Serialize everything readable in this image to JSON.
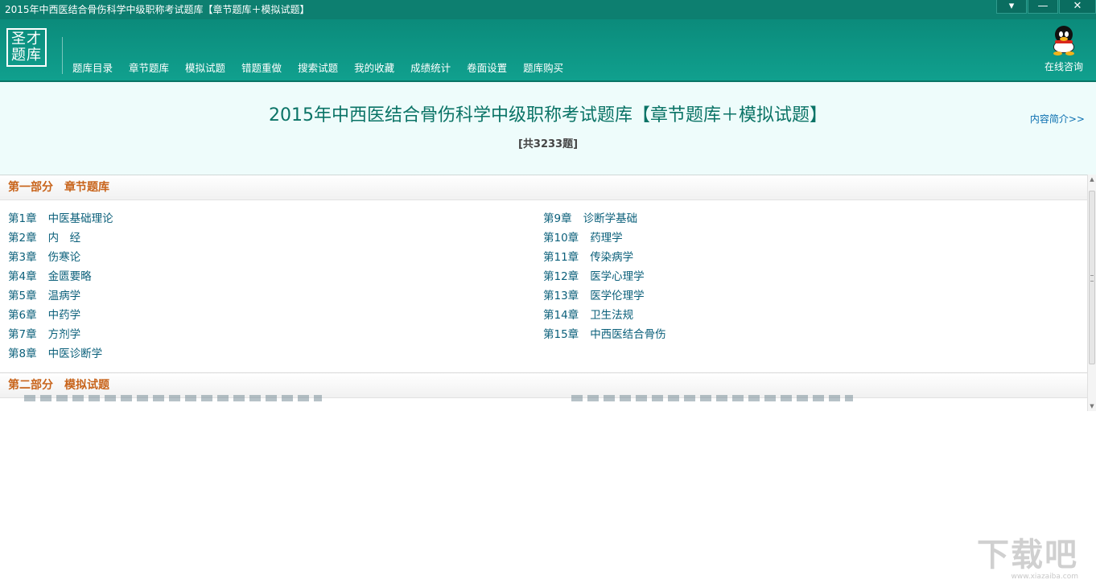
{
  "window": {
    "title": "2015年中西医结合骨伤科学中级职称考试题库【章节题库＋模拟试题】",
    "controls": [
      "▾",
      "—",
      "✕"
    ]
  },
  "header": {
    "logo": [
      "圣才",
      "题库"
    ],
    "nav": [
      "题库目录",
      "章节题库",
      "模拟试题",
      "错题重做",
      "搜索试题",
      "我的收藏",
      "成绩统计",
      "卷面设置",
      "题库购买"
    ],
    "online_label": "在线咨询"
  },
  "main": {
    "title": "2015年中西医结合骨伤科学中级职称考试题库【章节题库＋模拟试题】",
    "count": "[共3233题]",
    "intro_link": "内容简介>>"
  },
  "sections": [
    {
      "title": "第一部分　章节题库",
      "left": [
        {
          "num": "第1章",
          "name": "中医基础理论"
        },
        {
          "num": "第2章",
          "name": "内　经"
        },
        {
          "num": "第3章",
          "name": "伤寒论"
        },
        {
          "num": "第4章",
          "name": "金匮要略"
        },
        {
          "num": "第5章",
          "name": "温病学"
        },
        {
          "num": "第6章",
          "name": "中药学"
        },
        {
          "num": "第7章",
          "name": "方剂学"
        },
        {
          "num": "第8章",
          "name": "中医诊断学"
        }
      ],
      "right": [
        {
          "num": "第9章",
          "name": "诊断学基础"
        },
        {
          "num": "第10章",
          "name": "药理学"
        },
        {
          "num": "第11章",
          "name": "传染病学"
        },
        {
          "num": "第12章",
          "name": "医学心理学"
        },
        {
          "num": "第13章",
          "name": "医学伦理学"
        },
        {
          "num": "第14章",
          "name": "卫生法规"
        },
        {
          "num": "第15章",
          "name": "中西医结合骨伤"
        }
      ]
    },
    {
      "title": "第二部分　模拟试题"
    }
  ],
  "watermark": {
    "text": "下载吧",
    "url": "www.xiazaiba.com"
  }
}
